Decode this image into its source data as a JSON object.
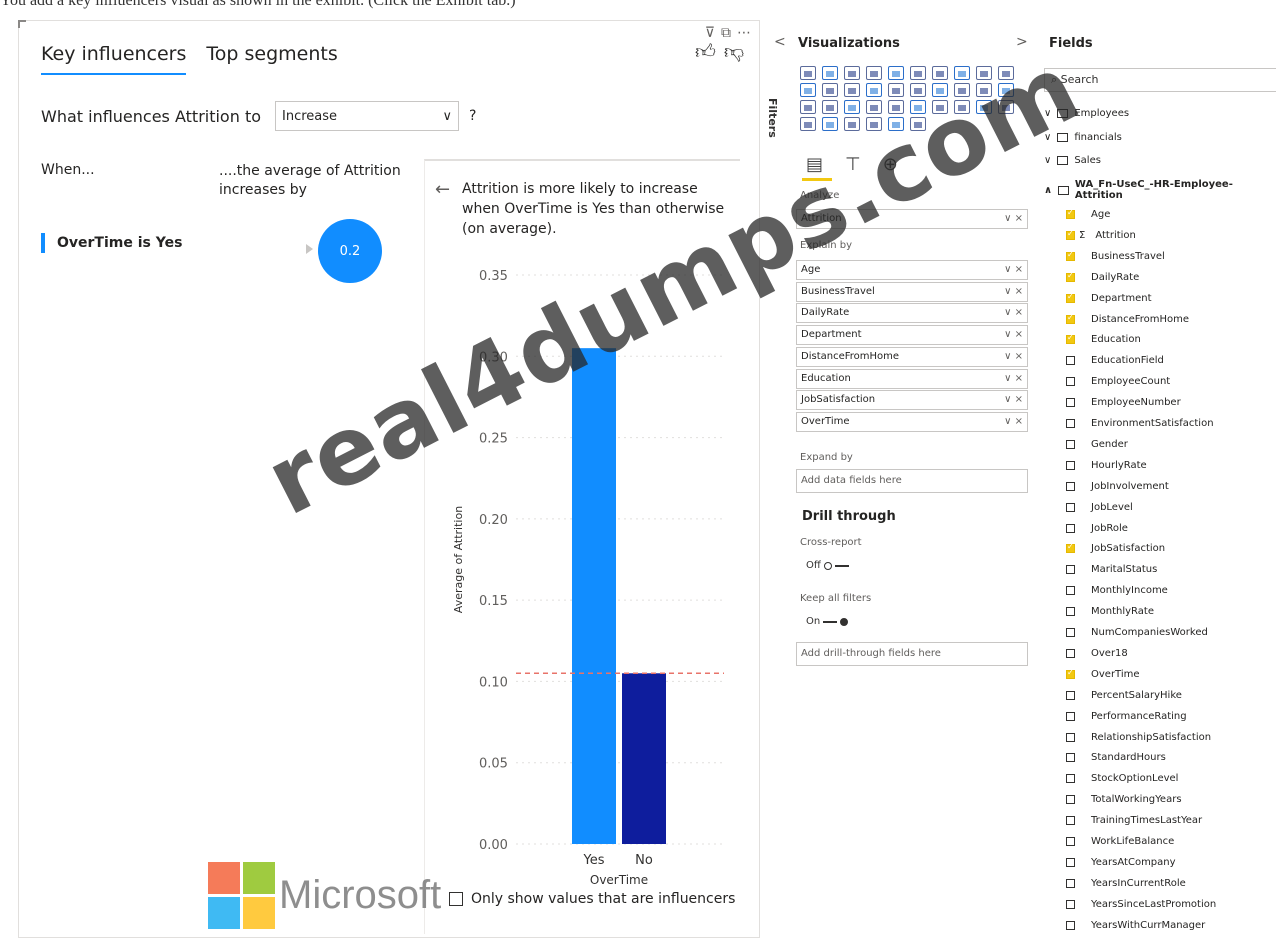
{
  "caption": "You add a key influencers visual as shown in the exhibit. (Click the Exhibit tab.)",
  "visual": {
    "tabs": [
      "Key influencers",
      "Top segments"
    ],
    "question_prefix": "What influences Attrition to",
    "dropdown_value": "Increase",
    "question_mark": "?",
    "when_label": "When...",
    "then_label": "....the average of Attrition increases by",
    "influencer_label": "OverTime is Yes",
    "influencer_value": "0.2",
    "detail_text": "Attrition is more likely to increase when OverTime is Yes than otherwise (on average).",
    "checkbox_label": "Only show values that are influencers",
    "logo_text": "Microsoft",
    "watermark": "real4dumps.com"
  },
  "chart_data": {
    "type": "bar",
    "categories": [
      "Yes",
      "No"
    ],
    "values": [
      0.305,
      0.105
    ],
    "colors": [
      "#118dff",
      "#0e1d9d"
    ],
    "reference_line": 0.105,
    "xlabel": "OverTime",
    "ylabel": "Average of Attrition",
    "ylim": [
      0,
      0.35
    ],
    "yticks": [
      "0.00",
      "0.05",
      "0.10",
      "0.15",
      "0.20",
      "0.25",
      "0.30",
      "0.35"
    ]
  },
  "visualizations": {
    "title": "Visualizations",
    "filters_label": "Filters",
    "analyze_label": "Analyze",
    "analyze_field": "Attrition",
    "explain_label": "Explain by",
    "explain_fields": [
      "Age",
      "BusinessTravel",
      "DailyRate",
      "Department",
      "DistanceFromHome",
      "Education",
      "JobSatisfaction",
      "OverTime"
    ],
    "expand_label": "Expand by",
    "expand_placeholder": "Add data fields here",
    "drill_title": "Drill through",
    "cross_report_label": "Cross-report",
    "cross_report_state": "Off",
    "keep_filters_label": "Keep all filters",
    "keep_filters_state": "On",
    "drill_placeholder": "Add drill-through fields here",
    "well_controls": "∨ ×"
  },
  "fields": {
    "title": "Fields",
    "search_placeholder": "Search",
    "tables": [
      "Employees",
      "financials",
      "Sales",
      "WA_Fn-UseC_-HR-Employee-Attrition"
    ],
    "columns": [
      {
        "name": "Age",
        "checked": true
      },
      {
        "name": "Attrition",
        "checked": true,
        "sigma": true
      },
      {
        "name": "BusinessTravel",
        "checked": true
      },
      {
        "name": "DailyRate",
        "checked": true
      },
      {
        "name": "Department",
        "checked": true
      },
      {
        "name": "DistanceFromHome",
        "checked": true
      },
      {
        "name": "Education",
        "checked": true
      },
      {
        "name": "EducationField",
        "checked": false
      },
      {
        "name": "EmployeeCount",
        "checked": false
      },
      {
        "name": "EmployeeNumber",
        "checked": false
      },
      {
        "name": "EnvironmentSatisfaction",
        "checked": false
      },
      {
        "name": "Gender",
        "checked": false
      },
      {
        "name": "HourlyRate",
        "checked": false
      },
      {
        "name": "JobInvolvement",
        "checked": false
      },
      {
        "name": "JobLevel",
        "checked": false
      },
      {
        "name": "JobRole",
        "checked": false
      },
      {
        "name": "JobSatisfaction",
        "checked": true
      },
      {
        "name": "MaritalStatus",
        "checked": false
      },
      {
        "name": "MonthlyIncome",
        "checked": false
      },
      {
        "name": "MonthlyRate",
        "checked": false
      },
      {
        "name": "NumCompaniesWorked",
        "checked": false
      },
      {
        "name": "Over18",
        "checked": false
      },
      {
        "name": "OverTime",
        "checked": true
      },
      {
        "name": "PercentSalaryHike",
        "checked": false
      },
      {
        "name": "PerformanceRating",
        "checked": false
      },
      {
        "name": "RelationshipSatisfaction",
        "checked": false
      },
      {
        "name": "StandardHours",
        "checked": false
      },
      {
        "name": "StockOptionLevel",
        "checked": false
      },
      {
        "name": "TotalWorkingYears",
        "checked": false
      },
      {
        "name": "TrainingTimesLastYear",
        "checked": false
      },
      {
        "name": "WorkLifeBalance",
        "checked": false
      },
      {
        "name": "YearsAtCompany",
        "checked": false
      },
      {
        "name": "YearsInCurrentRole",
        "checked": false
      },
      {
        "name": "YearsSinceLastPromotion",
        "checked": false
      },
      {
        "name": "YearsWithCurrManager",
        "checked": false
      }
    ]
  }
}
